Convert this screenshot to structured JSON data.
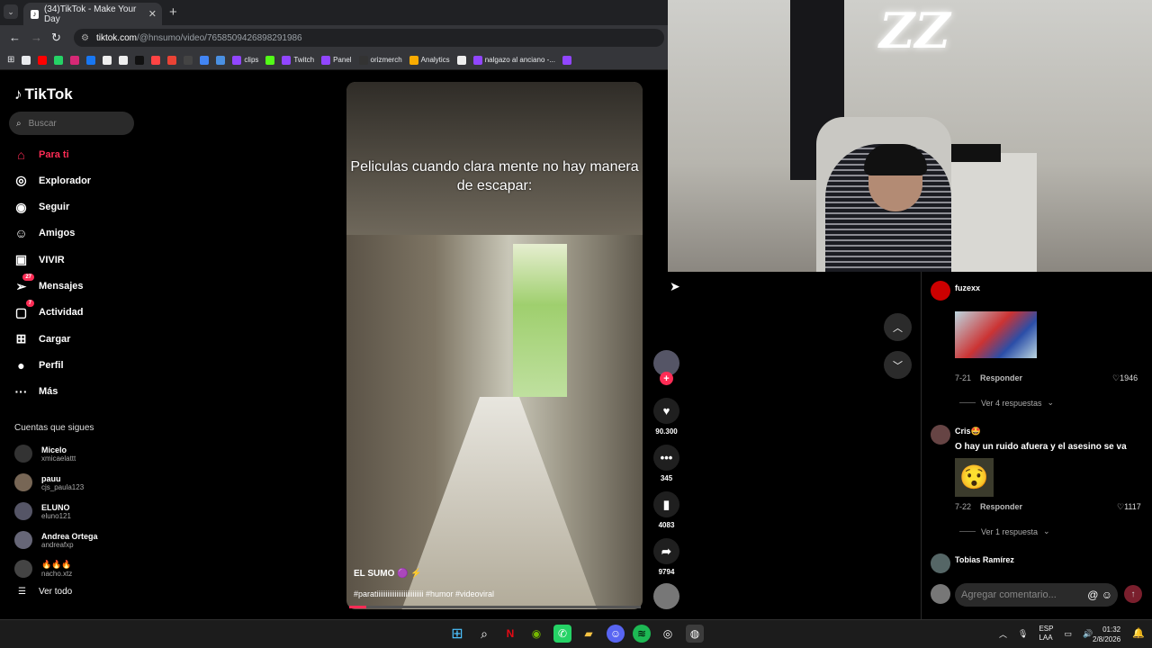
{
  "browser": {
    "tab_title": "(34)TikTok - Make Your Day",
    "tab_close": "✕",
    "new_tab": "+",
    "url_host": "tiktok.com",
    "url_path": "/@hnsumo/video/7658509426898291986",
    "bookmarks": [
      {
        "label": "",
        "color": "#e8eaed"
      },
      {
        "label": "",
        "color": "#ff0000"
      },
      {
        "label": "",
        "color": "#25d366"
      },
      {
        "label": "",
        "color": "#d62976"
      },
      {
        "label": "",
        "color": "#1877f2"
      },
      {
        "label": "",
        "color": "#eeeeee"
      },
      {
        "label": "",
        "color": "#eeeeee"
      },
      {
        "label": "",
        "color": "#111111"
      },
      {
        "label": "",
        "color": "#ff4444"
      },
      {
        "label": "",
        "color": "#ea4335"
      },
      {
        "label": "",
        "color": "#444444"
      },
      {
        "label": "",
        "color": "#4285f4"
      },
      {
        "label": "",
        "color": "#4a90e2"
      },
      {
        "label": "clips",
        "color": "#9146ff"
      },
      {
        "label": "",
        "color": "#53fc18"
      },
      {
        "label": "Twitch",
        "color": "#9146ff"
      },
      {
        "label": "Panel",
        "color": "#9146ff"
      },
      {
        "label": "orizmerch",
        "color": "#333333"
      },
      {
        "label": "Analytics",
        "color": "#f9ab00"
      },
      {
        "label": "",
        "color": "#eeeeee"
      },
      {
        "label": "nalgazo al anciano -...",
        "color": "#9146ff"
      },
      {
        "label": "",
        "color": "#9146ff"
      }
    ]
  },
  "sidebar": {
    "logo": "TikTok",
    "search_placeholder": "Buscar",
    "nav": [
      {
        "label": "Para ti",
        "icon": "home-icon",
        "glyph": "⌂",
        "active": true,
        "badge": ""
      },
      {
        "label": "Explorador",
        "icon": "compass-icon",
        "glyph": "◎",
        "active": false,
        "badge": ""
      },
      {
        "label": "Seguir",
        "icon": "following-avatar-icon",
        "glyph": "◉",
        "active": false,
        "badge": ""
      },
      {
        "label": "Amigos",
        "icon": "friends-icon",
        "glyph": "☺",
        "active": false,
        "badge": ""
      },
      {
        "label": "VIVIR",
        "icon": "live-icon",
        "glyph": "▣",
        "active": false,
        "badge": ""
      },
      {
        "label": "Mensajes",
        "icon": "messages-icon",
        "glyph": "➢",
        "active": false,
        "badge": "27"
      },
      {
        "label": "Actividad",
        "icon": "activity-icon",
        "glyph": "▢",
        "active": false,
        "badge": "7"
      },
      {
        "label": "Cargar",
        "icon": "upload-icon",
        "glyph": "⊞",
        "active": false,
        "badge": ""
      },
      {
        "label": "Perfil",
        "icon": "profile-avatar-icon",
        "glyph": "●",
        "active": false,
        "badge": ""
      },
      {
        "label": "Más",
        "icon": "more-icon",
        "glyph": "···",
        "active": false,
        "badge": ""
      }
    ],
    "following_title": "Cuentas que sigues",
    "following": [
      {
        "name": "Micelo",
        "user": "xmicaelattt"
      },
      {
        "name": "pauu",
        "user": "cjs_paula123"
      },
      {
        "name": "ELUNO",
        "user": "eluno121"
      },
      {
        "name": "Andrea Ortega",
        "user": "andreafxp"
      },
      {
        "name": "🔥🔥🔥",
        "user": "nacho.xtz"
      }
    ],
    "see_all": "Ver todo"
  },
  "video": {
    "caption": "Peliculas cuando clara mente no hay manera de escapar:",
    "author": "EL SUMO 🟣 ⚡",
    "tags": "#paratiiiiiiiiiiiiiiiiiiiiiiiiii #humor #videoviral",
    "progress": 0.06
  },
  "actions": {
    "likes": "90.300",
    "comments": "345",
    "saves": "4083",
    "shares": "9794"
  },
  "webcam": {
    "logo": "ZZ"
  },
  "comments": {
    "items": [
      {
        "name": "fuzexx",
        "date": "7-21",
        "reply": "Responder",
        "likes": "1946",
        "replies": "Ver 4 respuestas",
        "text": ""
      },
      {
        "name": "Cris🤩",
        "date": "7-22",
        "reply": "Responder",
        "likes": "1117",
        "replies": "Ver 1 respuesta",
        "text": "O hay un ruido afuera y el asesino se va"
      },
      {
        "name": "Tobias Ramírez",
        "date": "",
        "reply": "",
        "likes": "",
        "replies": "",
        "text": ""
      }
    ],
    "input_placeholder": "Agregar comentario..."
  },
  "taskbar": {
    "lang": "ESP",
    "lang2": "LAA",
    "time": "01:32",
    "date": "2/8/2026"
  }
}
